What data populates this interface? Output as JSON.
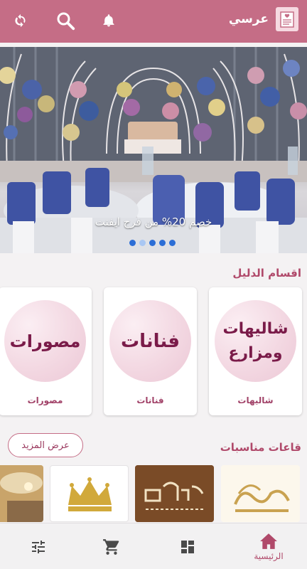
{
  "app": {
    "name": "عرسي"
  },
  "topbar": {
    "icons": [
      "refresh-icon",
      "search-icon",
      "bell-icon",
      "app-logo"
    ]
  },
  "banner": {
    "caption": "خصم 20% من فرح ايفنت",
    "slide_count": 5,
    "active_slide": 1
  },
  "categories": {
    "title": "اقسام الدليل",
    "items": [
      {
        "circle_text_line1": "شاليهات",
        "circle_text_line2": "ومزارع",
        "label": "شاليهات"
      },
      {
        "circle_text_line1": "فنانات",
        "circle_text_line2": "",
        "label": "فنانات"
      },
      {
        "circle_text_line1": "مصورات",
        "circle_text_line2": "",
        "label": "مصورات"
      }
    ]
  },
  "venues_section": {
    "title": "قاعات مناسبات",
    "more_label": "عرض المزيد"
  },
  "bottom_nav": {
    "home_label": "الرئيسية",
    "items": [
      "home-icon",
      "dashboard-icon",
      "cart-icon",
      "filter-icon"
    ]
  },
  "colors": {
    "primary": "#c56d86",
    "accent_text": "#b0496a",
    "circle_text": "#7a1b49"
  }
}
